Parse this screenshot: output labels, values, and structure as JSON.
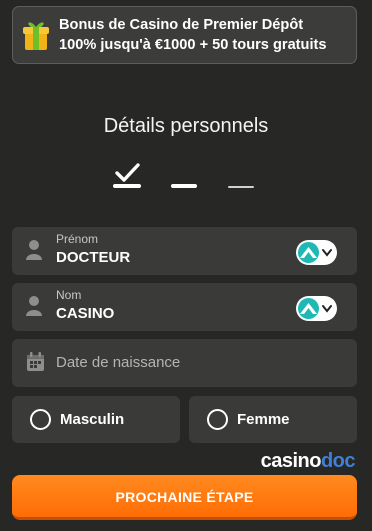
{
  "bonus": {
    "line1": "Bonus de Casino de Premier Dépôt",
    "line2": "100% jusqu'à €1000 + 50 tours gratuits",
    "icon": "gift-icon"
  },
  "page": {
    "title": "Détails personnels"
  },
  "steps": {
    "current": 1,
    "total": 3
  },
  "form": {
    "first_name": {
      "label": "Prénom",
      "value": "DOCTEUR"
    },
    "last_name": {
      "label": "Nom",
      "value": "CASINO"
    },
    "birthdate": {
      "placeholder": "Date de naissance"
    },
    "gender": {
      "male": "Masculin",
      "female": "Femme"
    }
  },
  "brand": {
    "name_part1": "casino",
    "name_part2": "doc",
    "accent_color": "#3f7fd6"
  },
  "cta": {
    "label": "PROCHAINE ÉTAPE",
    "color": "#ff7a12"
  }
}
